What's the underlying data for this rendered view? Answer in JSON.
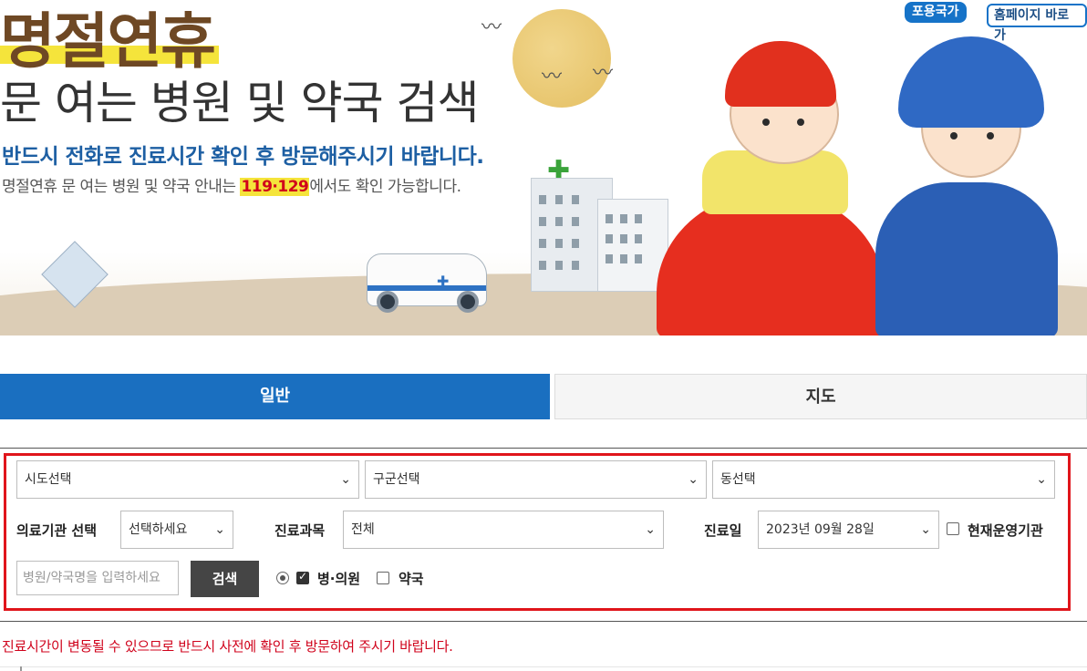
{
  "banner": {
    "title_main": "명절연휴",
    "title_sub": "문 여는 병원 및 약국 검색",
    "line1": "반드시 전화로 진료시간 확인 후 방문해주시기 바랍니다.",
    "line2_prefix": "명절연휴 문 여는 병원 및 약국 안내는 ",
    "line2_emphasis": "119·129",
    "line2_suffix": "에서도 확인 가능합니다.",
    "badge_country": "포용국가",
    "badge_home": "홈페이지 바로가"
  },
  "tabs": [
    {
      "label": "일반",
      "active": true
    },
    {
      "label": "지도",
      "active": false
    }
  ],
  "filters": {
    "sido": "시도선택",
    "gugun": "구군선택",
    "dong": "동선택",
    "institution_label": "의료기관 선택",
    "institution_value": "선택하세요",
    "department_label": "진료과목",
    "department_value": "전체",
    "date_label": "진료일",
    "date_value": "2023년 09월 28일",
    "operating_label": "현재운영기관"
  },
  "search": {
    "placeholder": "병원/약국명을 입력하세요",
    "button": "검색",
    "opt_hospital": "병·의원",
    "opt_pharmacy": "약국"
  },
  "notice": "진료시간이 변동될 수 있으므로 반드시 사전에 확인 후 방문하여 주시기 바랍니다.",
  "colors": {
    "primary": "#1a6fc0",
    "alert": "#e0151b",
    "button_dark": "#454545"
  }
}
